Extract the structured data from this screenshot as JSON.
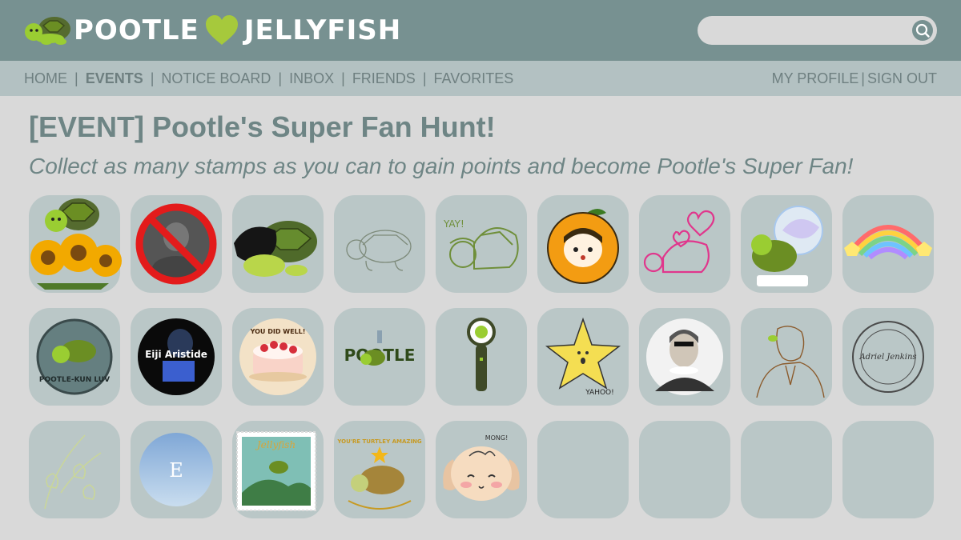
{
  "header": {
    "brand_left": "POOTLE",
    "brand_right": "JELLYFISH",
    "logo_icon": "turtle-icon",
    "heart_icon": "heart-icon",
    "brand_color": "#a6c93c",
    "search": {
      "placeholder": "",
      "value": "",
      "icon": "search-icon"
    }
  },
  "nav": {
    "items": [
      {
        "label": "HOME",
        "active": false
      },
      {
        "label": "EVENTS",
        "active": true
      },
      {
        "label": "NOTICE BOARD",
        "active": false
      },
      {
        "label": "INBOX",
        "active": false
      },
      {
        "label": "FRIENDS",
        "active": false
      },
      {
        "label": "FAVORITES",
        "active": false
      }
    ],
    "separator": "|",
    "my_profile": "MY PROFILE",
    "sign_out": "SIGN OUT",
    "right_separator": "|"
  },
  "event": {
    "title": "[EVENT] Pootle's Super Fan Hunt!",
    "subtitle": "Collect as many stamps as you can to gain points and become Pootle's Super Fan!"
  },
  "stamps": {
    "collected_count": 23,
    "total_slots": 27,
    "items": [
      {
        "name": "turtle-sunflowers-stamp",
        "text": ""
      },
      {
        "name": "no-sign-stamp",
        "text": ""
      },
      {
        "name": "turtle-black-hair-stamp",
        "text": ""
      },
      {
        "name": "turtle-sketch-stamp",
        "text": ""
      },
      {
        "name": "yay-turtle-stamp",
        "text": "YAY!"
      },
      {
        "name": "orange-girl-stamp",
        "text": ""
      },
      {
        "name": "pink-turtle-hearts-stamp",
        "text": ""
      },
      {
        "name": "turtle-gem-stamp",
        "text": ""
      },
      {
        "name": "rainbow-stamp",
        "text": ""
      },
      {
        "name": "pootle-kun-luv-stamp",
        "text": "POOTLE-KUN LUV"
      },
      {
        "name": "eiji-aristide-stamp",
        "text": "Eiji Aristide"
      },
      {
        "name": "cake-stamp",
        "text": "YOU DID WELL!"
      },
      {
        "name": "pootle-logo-stamp",
        "text": "POOTLE"
      },
      {
        "name": "lightstick-stamp",
        "text": ""
      },
      {
        "name": "star-yahoo-stamp",
        "text": "YAHOO!"
      },
      {
        "name": "shakespeare-stamp",
        "text": ""
      },
      {
        "name": "sketch-man-stamp",
        "text": ""
      },
      {
        "name": "adriel-jenkins-stamp",
        "text": "Adriel Jenkins"
      },
      {
        "name": "lily-flowers-stamp",
        "text": ""
      },
      {
        "name": "blue-e-stamp",
        "text": "E"
      },
      {
        "name": "jellyfish-postage-stamp",
        "text": "Jellyfish"
      },
      {
        "name": "turtley-amazing-stamp",
        "text": "YOU'RE TURTLEY AMAZING"
      },
      {
        "name": "puppy-mong-stamp",
        "text": "MONG!"
      }
    ]
  },
  "colors": {
    "header_bg": "#779191",
    "nav_bg": "#b3c1c2",
    "page_bg": "#d9d9d9",
    "tile_bg": "#bac7c7",
    "title_color": "#6e8585"
  }
}
